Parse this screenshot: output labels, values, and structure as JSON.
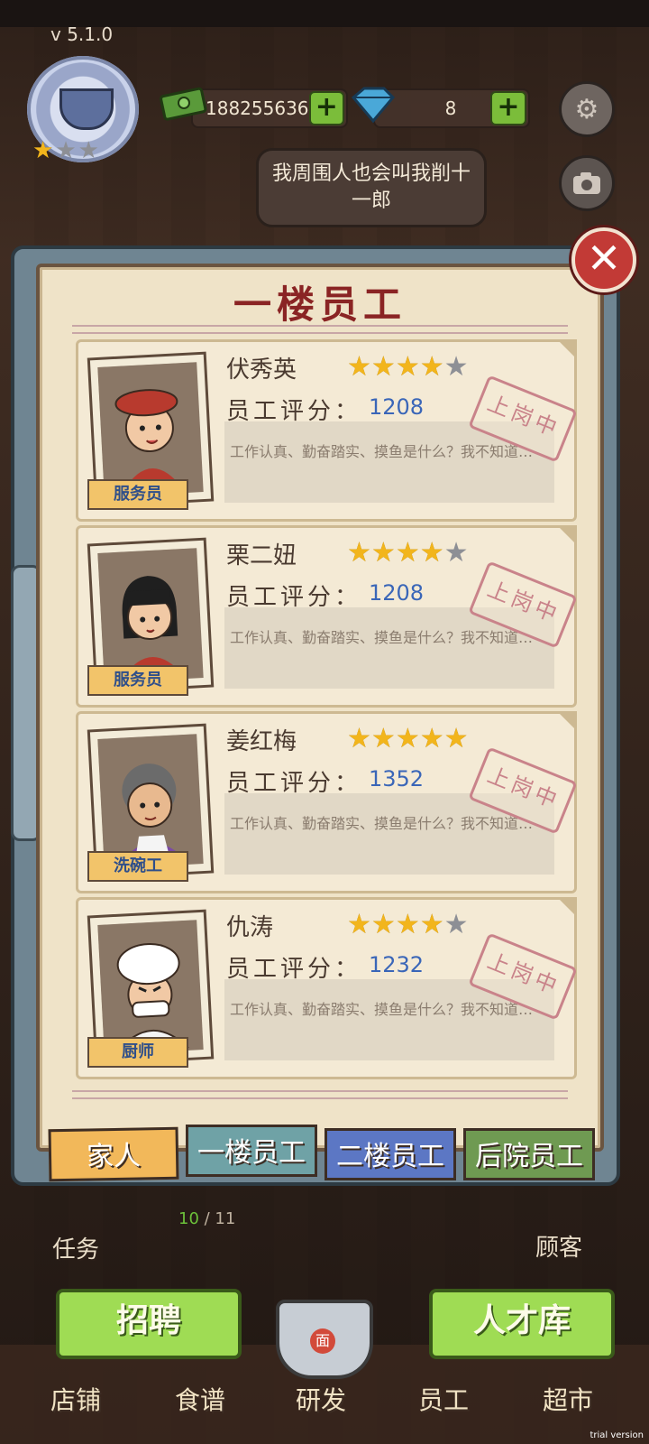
{
  "version": "v 5.1.0",
  "currency": {
    "cash": "188255636",
    "gems": "8",
    "plus_label": "+"
  },
  "icons": {
    "settings": "gear-icon",
    "camera": "camera-icon",
    "close": "close-icon"
  },
  "close_label": "✕",
  "speech_bubble": "我周围人也会叫我削十一郎",
  "panel_title": "一楼员工",
  "score_label": "员工评分：",
  "stamp_text": "上岗中",
  "employees": [
    {
      "name": "伏秀英",
      "stars": 4,
      "score": "1208",
      "role": "服务员",
      "desc": "工作认真、勤奋踏实、摸鱼是什么？我不知道…"
    },
    {
      "name": "栗二妞",
      "stars": 4,
      "score": "1208",
      "role": "服务员",
      "desc": "工作认真、勤奋踏实、摸鱼是什么？我不知道…"
    },
    {
      "name": "姜红梅",
      "stars": 5,
      "score": "1352",
      "role": "洗碗工",
      "desc": "工作认真、勤奋踏实、摸鱼是什么？我不知道…"
    },
    {
      "name": "仇涛",
      "stars": 4,
      "score": "1232",
      "role": "厨师",
      "desc": "工作认真、勤奋踏实、摸鱼是什么？我不知道…"
    }
  ],
  "tabs": [
    {
      "label": "家人",
      "color": "#f2b85a"
    },
    {
      "label": "一楼员工",
      "color": "#6fa2a6"
    },
    {
      "label": "二楼员工",
      "color": "#5c77c4"
    },
    {
      "label": "后院员工",
      "color": "#6f9a52"
    }
  ],
  "hud": {
    "task": "任务",
    "customer": "顾客",
    "progress_current": "10",
    "progress_total": "/ 11"
  },
  "buttons": {
    "recruit": "招聘",
    "talent": "人才库"
  },
  "bottom_nav": [
    "店铺",
    "食谱",
    "研发",
    "员工",
    "超市"
  ],
  "pot_label": "面",
  "watermark": "trial version"
}
